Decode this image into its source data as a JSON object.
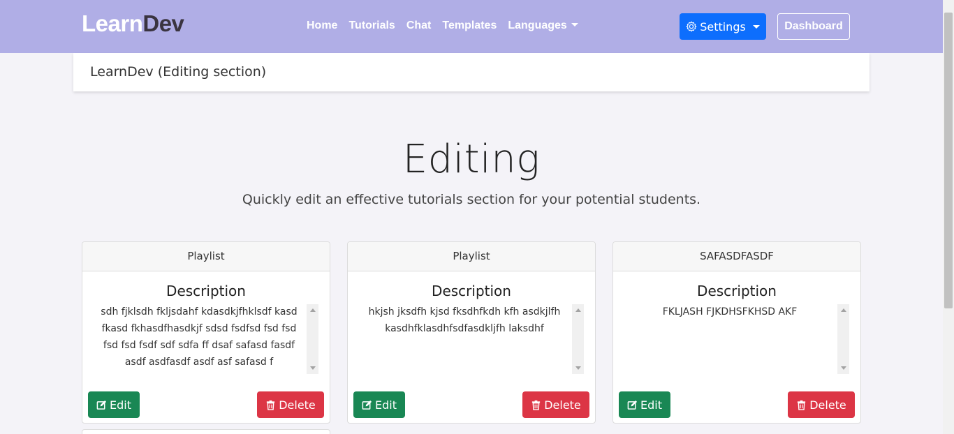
{
  "navbar": {
    "brand_part1": "Learn",
    "brand_part2": "Dev",
    "links": [
      "Home",
      "Tutorials",
      "Chat",
      "Templates",
      "Languages"
    ],
    "settings_label": "Settings",
    "dashboard_label": "Dashboard",
    "bg_color": "#b0aee6"
  },
  "section_bar": {
    "title": "LearnDev (Editing section)"
  },
  "hero": {
    "title": "Editing",
    "subtitle": "Quickly edit an effective tutorials section for your potential students."
  },
  "cards": [
    {
      "header": "Playlist",
      "desc_title": "Description",
      "text": "sdh fjklsdh fkljsdahf kdasdkjfhklsdf kasd fkasd fkhasdfhasdkjf sdsd fsdfsd fsd fsd fsd fsd fsdf sdf sdfa ff dsaf safasd fasdf asdf asdfasdf asdf asf safasd f",
      "edit_label": "Edit",
      "delete_label": "Delete"
    },
    {
      "header": "Playlist",
      "desc_title": "Description",
      "text": "hkjsh jksdfh kjsd fksdhfkdh kfh asdkjlfh kasdhfklasdhfsdfasdkljfh laksdhf",
      "edit_label": "Edit",
      "delete_label": "Delete"
    },
    {
      "header": "SAFASDFASDF",
      "desc_title": "Description",
      "text": "FKLJASH FJKDHSFKHSD AKF",
      "edit_label": "Edit",
      "delete_label": "Delete"
    }
  ],
  "colors": {
    "primary": "#0d6efd",
    "success": "#198754",
    "danger": "#dc3545"
  }
}
